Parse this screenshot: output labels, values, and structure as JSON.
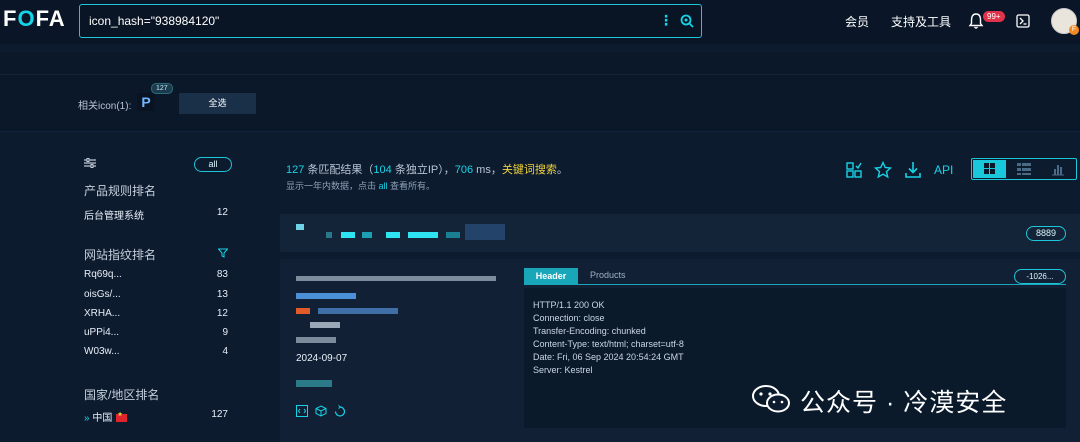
{
  "header": {
    "logo": {
      "a": "F",
      "b": "O",
      "c": "FA"
    },
    "search_value": "icon_hash=\"938984120\"",
    "nav_member": "会员",
    "nav_tools": "支持及工具",
    "notification_badge": "99+",
    "avatar_badge": "F"
  },
  "icon_row": {
    "label": "相关icon(1):",
    "favicon_glyph": "P",
    "favicon_count": "127",
    "select_all": "全选"
  },
  "sidebar": {
    "all_pill": "all",
    "product_title": "产品规则排名",
    "products": [
      {
        "name": "后台管理系统",
        "count": "12"
      }
    ],
    "fingerprint_title": "网站指纹排名",
    "fingerprints": [
      {
        "name": "Rq69q...",
        "count": "83"
      },
      {
        "name": "oisGs/...",
        "count": "13"
      },
      {
        "name": "XRHA...",
        "count": "12"
      },
      {
        "name": "uPPi4...",
        "count": "9"
      },
      {
        "name": "W03w...",
        "count": "4"
      }
    ],
    "country_title": "国家/地区排名",
    "countries": [
      {
        "name": "中国",
        "count": "127"
      }
    ]
  },
  "results": {
    "count": "127",
    "count_suffix": " 条匹配结果（",
    "ip_count": "104",
    "ip_suffix": " 条独立IP），",
    "time": "706",
    "time_suffix": " ms，",
    "keyword_search": "关键词搜索",
    "end": "。",
    "sub_prefix": "显示一年内数据，点击 ",
    "sub_link": "all",
    "sub_suffix": " 查看所有。",
    "api": "API"
  },
  "card": {
    "port": "8889",
    "date": "2024-09-07",
    "tab_header": "Header",
    "tab_products": "Products",
    "hash": "-1026...",
    "http_lines": [
      "HTTP/1.1 200 OK",
      "Connection: close",
      "Transfer-Encoding: chunked",
      "Content-Type: text/html; charset=utf-8",
      "Date: Fri, 06 Sep 2024 20:54:24 GMT",
      "Server: Kestrel"
    ]
  },
  "watermark": "公众号 · 冷漠安全",
  "colors": {
    "accent": "#17d3e6",
    "keyword": "#f2d23a",
    "background": "#0d1b2e",
    "badge": "#e0324b"
  }
}
